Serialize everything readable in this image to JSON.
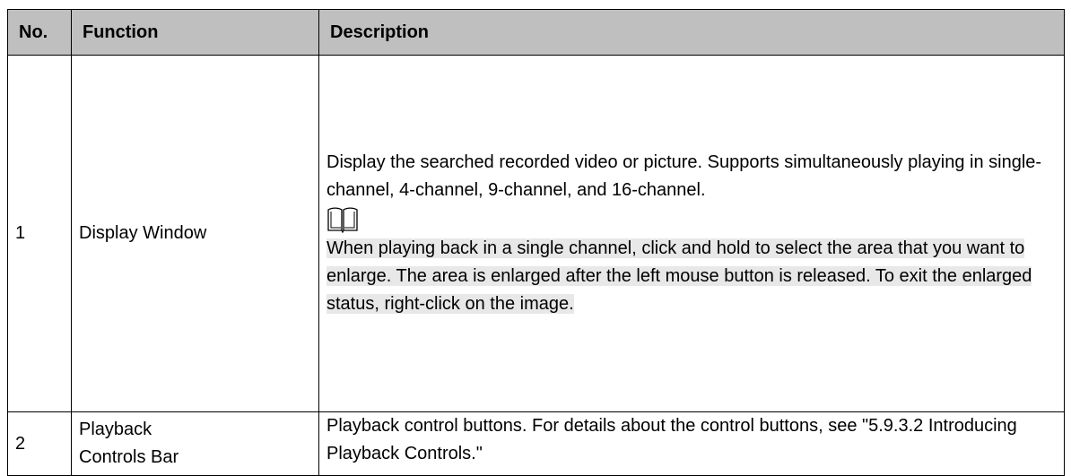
{
  "table": {
    "headers": {
      "no": "No.",
      "function": "Function",
      "description": "Description"
    },
    "rows": [
      {
        "no": "1",
        "function": "Display Window",
        "description": "Display the searched recorded video or picture. Supports simultaneously playing in single-channel, 4-channel, 9-channel, and 16-channel.",
        "note_icon": "book-icon",
        "note": "When playing back in a single channel, click and hold to select the area that you want to enlarge. The area is enlarged after the left mouse button is released. To exit the enlarged status, right-click on the image."
      },
      {
        "no": "2",
        "function_line1": "Playback",
        "function_line2": "Controls Bar",
        "description": "Playback control buttons. For details about the control buttons, see \"5.9.3.2 Introducing Playback Controls.\""
      }
    ]
  },
  "colors": {
    "header_bg": "#bfbfbf",
    "note_bg": "#e8e8e8",
    "border": "#000000"
  }
}
